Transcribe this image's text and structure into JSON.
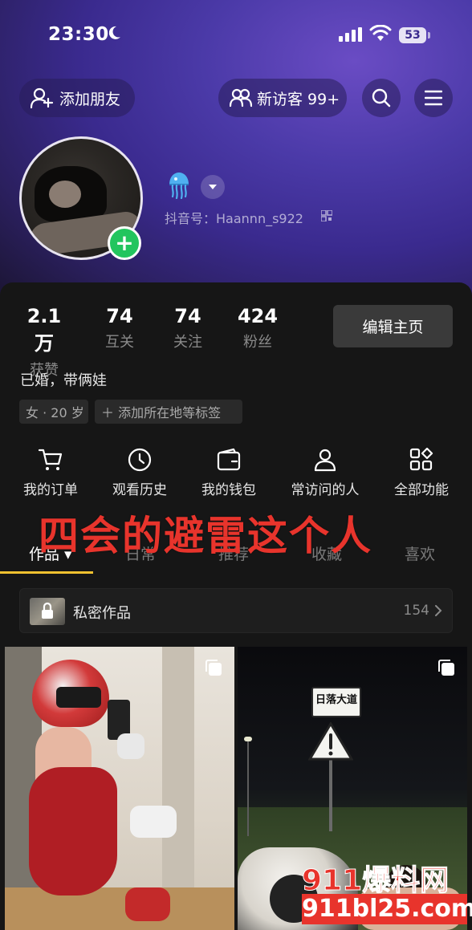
{
  "status_bar": {
    "time": "23:30",
    "battery": "53"
  },
  "header": {
    "add_friend_label": "添加朋友",
    "visitor_label": "新访客 99+"
  },
  "profile": {
    "douyin_id_label": "抖音号：",
    "douyin_id": "Haannn_s922"
  },
  "stats": [
    {
      "value": "2.1万",
      "label": "获赞"
    },
    {
      "value": "74",
      "label": "互关"
    },
    {
      "value": "74",
      "label": "关注"
    },
    {
      "value": "424",
      "label": "粉丝"
    }
  ],
  "edit_profile_label": "编辑主页",
  "bio": "已婚，带俩娃",
  "tags": {
    "gender_age": "女 · 20 岁",
    "add_location": "＋ 添加所在地等标签"
  },
  "functions": [
    {
      "label": "我的订单",
      "icon": "cart-icon"
    },
    {
      "label": "观看历史",
      "icon": "clock-icon"
    },
    {
      "label": "我的钱包",
      "icon": "wallet-icon"
    },
    {
      "label": "常访问的人",
      "icon": "person-icon"
    },
    {
      "label": "全部功能",
      "icon": "grid-icon"
    }
  ],
  "overlay_text": "四会的避雷这个人",
  "tabs": [
    {
      "label": "作品 ▾",
      "active": true
    },
    {
      "label": "日常",
      "active": false
    },
    {
      "label": "推荐",
      "active": false
    },
    {
      "label": "收藏",
      "active": false
    },
    {
      "label": "喜欢",
      "active": false
    }
  ],
  "private_works": {
    "label": "私密作品",
    "count": "154"
  },
  "posts": [
    {
      "sign_text": ""
    },
    {
      "sign_text": "日落大道"
    }
  ],
  "watermark": {
    "line1": "911爆料网",
    "line2": "911bl25.com"
  },
  "colors": {
    "accent_tab": "#f2c230",
    "overlay_red": "#e8342c",
    "badge_green": "#22c55e"
  }
}
